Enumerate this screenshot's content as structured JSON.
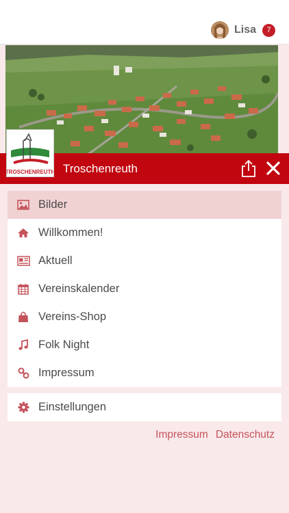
{
  "header": {
    "user_name": "Lisa",
    "notification_count": "7",
    "avatar_icon": "user-avatar"
  },
  "banner": {
    "logo_text": "TROSCHENREUTH"
  },
  "titlebar": {
    "title": "Troschenreuth",
    "share_icon": "share-icon",
    "close_icon": "close-icon"
  },
  "menu": {
    "items": [
      {
        "label": "Bilder",
        "icon": "image-icon",
        "active": true
      },
      {
        "label": "Willkommen!",
        "icon": "home-icon",
        "active": false
      },
      {
        "label": "Aktuell",
        "icon": "newspaper-icon",
        "active": false
      },
      {
        "label": "Vereinskalender",
        "icon": "calendar-icon",
        "active": false
      },
      {
        "label": "Vereins-Shop",
        "icon": "shopping-bag-icon",
        "active": false
      },
      {
        "label": "Folk Night",
        "icon": "music-note-icon",
        "active": false
      },
      {
        "label": "Impressum",
        "icon": "link-icon",
        "active": false
      }
    ],
    "settings": {
      "label": "Einstellungen",
      "icon": "gear-icon"
    }
  },
  "footer": {
    "impressum_label": "Impressum",
    "datenschutz_label": "Datenschutz"
  },
  "colors": {
    "brand_red": "#c10610",
    "icon_red": "#c4535a",
    "background": "#f9e9ea",
    "active_item": "#f1d2d3"
  }
}
